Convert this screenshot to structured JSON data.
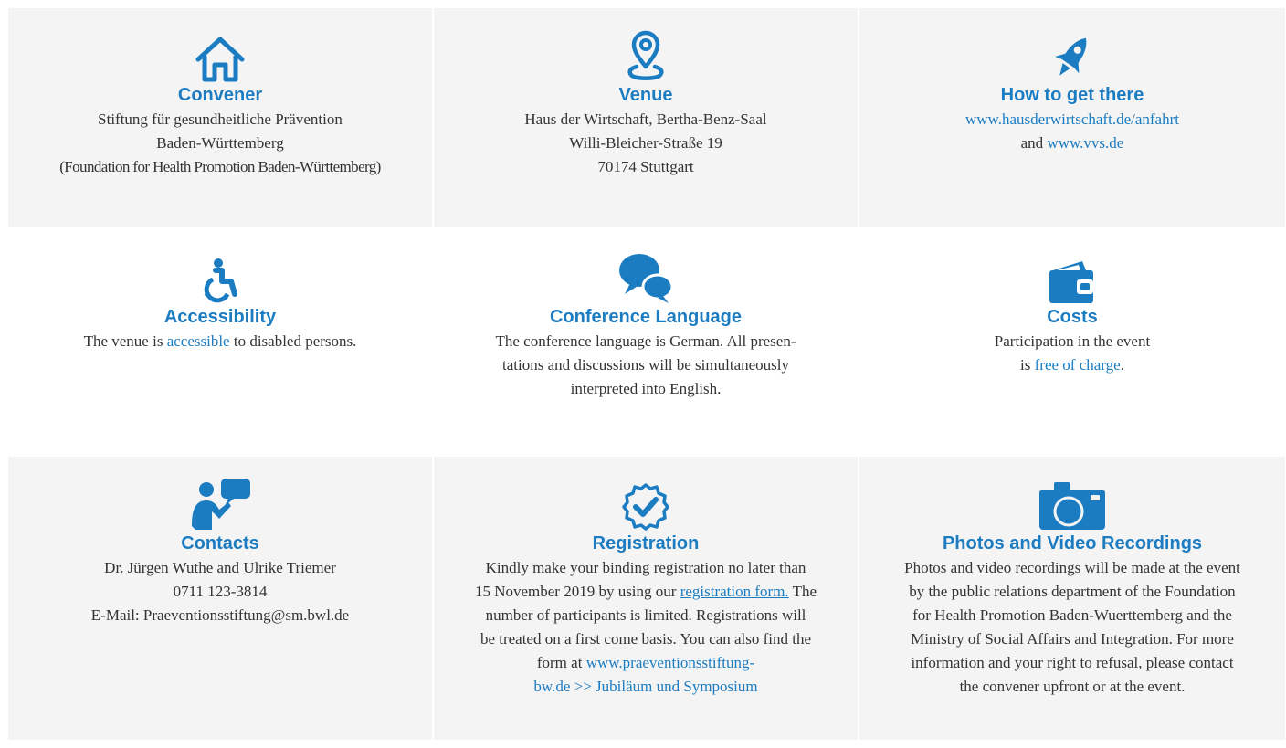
{
  "colors": {
    "accent": "#1c7cc2",
    "panel_grey": "#f4f4f4",
    "text": "#333333"
  },
  "cards": {
    "convener": {
      "icon": "house-icon",
      "title": "Convener",
      "lines": [
        "Stiftung für gesundheitliche Prävention",
        "Baden-Württemberg",
        "(Foundation for Health Promotion Baden-Württemberg)"
      ]
    },
    "venue": {
      "icon": "map-pin-icon",
      "title": "Venue",
      "lines": [
        "Haus der Wirtschaft, Bertha-Benz-Saal",
        "Willi-Bleicher-Straße 19",
        "70174 Stuttgart"
      ]
    },
    "how_to_get_there": {
      "icon": "rocket-icon",
      "title": "How to get there",
      "link1": "www.hausderwirtschaft.de/anfahrt",
      "and": "and",
      "link2": "www.vvs.de"
    },
    "accessibility": {
      "icon": "wheelchair-icon",
      "title": "Accessibility",
      "pre": "The venue is",
      "link": "accessible",
      "post": "to disabled persons."
    },
    "conference_language": {
      "icon": "speech-bubbles-icon",
      "title": "Conference Language",
      "lines": [
        "The conference language is German. All presen-",
        "tations and discussions will be simultaneously",
        "interpreted into English."
      ]
    },
    "costs": {
      "icon": "wallet-icon",
      "title": "Costs",
      "line1": "Participation in the event",
      "pre": "is",
      "link": "free of charge",
      "post": "."
    },
    "contacts": {
      "icon": "person-speaking-icon",
      "title": "Contacts",
      "lines": [
        "Dr. Jürgen Wuthe and Ulrike Triemer",
        "0711 123-3814",
        "E-Mail: Praeventionsstiftung@sm.bwl.de"
      ]
    },
    "registration": {
      "icon": "check-circle-icon",
      "title": "Registration",
      "line1": "Kindly make your binding registration no later than",
      "line2_pre": "15 November 2019 by using our",
      "line2_link": "registration form.",
      "line2_post": "The",
      "line3": "number of participants is limited. Registrations will",
      "line4": "be treated on a first come basis. You can also find the",
      "line5_pre": "form at",
      "line5_link": "www.praeventionsstiftung-",
      "line6_link": "bw.de >> Jubiläum und Symposium"
    },
    "photos": {
      "icon": "camera-icon",
      "title": "Photos and Video Recordings",
      "lines": [
        "Photos and video recordings will be made at the event",
        "by the public relations department of the Foundation",
        "for Health Promotion Baden-Wuerttemberg and the",
        "Ministry of Social Affairs and Integration. For more",
        "information and your right to refusal, please contact",
        "the convener upfront or at the event."
      ]
    }
  }
}
